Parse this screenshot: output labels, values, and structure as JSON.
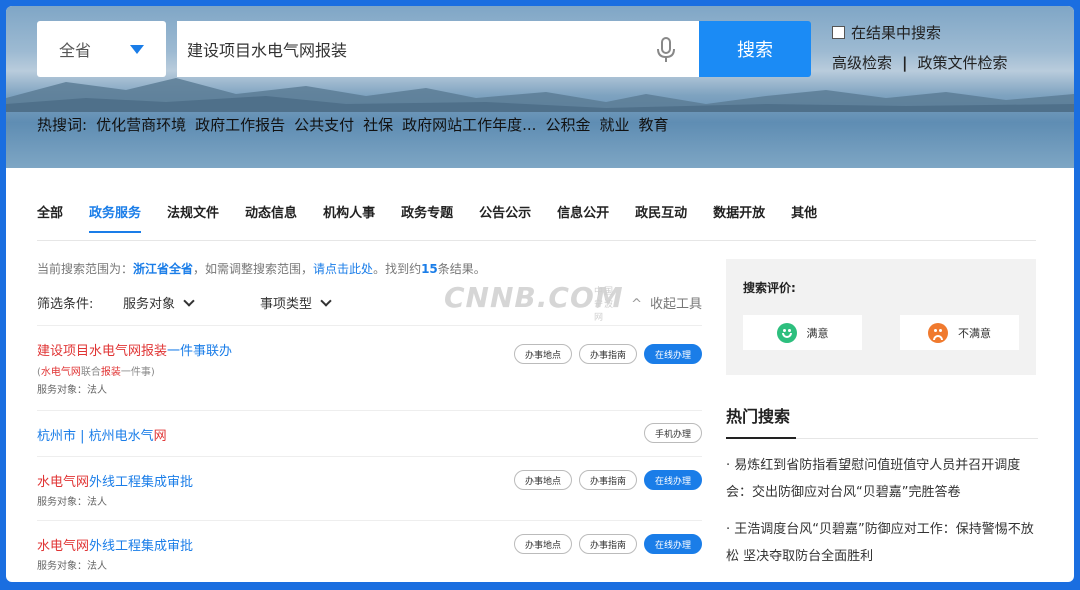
{
  "search": {
    "region": "全省",
    "value": "建设项目水电气网报装",
    "button": "搜索",
    "in_result": "在结果中搜索",
    "advanced": "高级检索",
    "separator": "|",
    "policy": "政策文件检索"
  },
  "hot": {
    "label": "热搜词:",
    "words": [
      "优化营商环境",
      "政府工作报告",
      "公共支付",
      "社保",
      "政府网站工作年度...",
      "公积金",
      "就业",
      "教育"
    ]
  },
  "tabs": [
    "全部",
    "政务服务",
    "法规文件",
    "动态信息",
    "机构人事",
    "政务专题",
    "公告公示",
    "信息公开",
    "政民互动",
    "数据开放",
    "其他"
  ],
  "active_tab": 1,
  "scope": {
    "prefix": "当前搜索范围为：",
    "scope": "浙江省全省",
    "mid": "，如需调整搜索范围，",
    "link": "请点击此处",
    "found": "。找到约",
    "count": "15",
    "suffix": "条结果。"
  },
  "filters": {
    "label": "筛选条件:",
    "f1": "服务对象",
    "f2": "事项类型",
    "collapse": "收起工具"
  },
  "watermark": {
    "text": "CNNB.COM",
    "sub": "中国宁波网"
  },
  "results": [
    {
      "title_red": "建设项目水电气网报装",
      "title_rest": "一件事联办",
      "sub_open": "(",
      "sub_red1": "水电气网",
      "sub_mid": "联合",
      "sub_red2": "报装",
      "sub_end": "一件事)",
      "target": "服务对象：法人",
      "buttons": [
        "办事地点",
        "办事指南",
        "在线办理"
      ]
    },
    {
      "title_blue": "杭州市 | 杭州电水气",
      "title_red": "网",
      "buttons": [
        "手机办理"
      ]
    },
    {
      "title_red": "水电气网",
      "title_rest": "外线工程集成审批",
      "target": "服务对象：法人",
      "buttons": [
        "办事地点",
        "办事指南",
        "在线办理"
      ]
    },
    {
      "title_red": "水电气网",
      "title_rest": "外线工程集成审批",
      "target": "服务对象：法人",
      "buttons": [
        "办事地点",
        "办事指南",
        "在线办理"
      ]
    }
  ],
  "rating": {
    "title": "搜索评价:",
    "good": "满意",
    "bad": "不满意"
  },
  "hot_search": {
    "title": "热门搜索",
    "items": [
      "易炼红到省防指看望慰问值班值守人员并召开调度会：交出防御应对台风“贝碧嘉”完胜答卷",
      "王浩调度台风“贝碧嘉”防御应对工作：保持警惕不放松 坚决夺取防台全面胜利"
    ]
  },
  "colors": {
    "accent": "#1a7de8",
    "highlight": "#e03434",
    "frame": "#1a6ee0"
  }
}
